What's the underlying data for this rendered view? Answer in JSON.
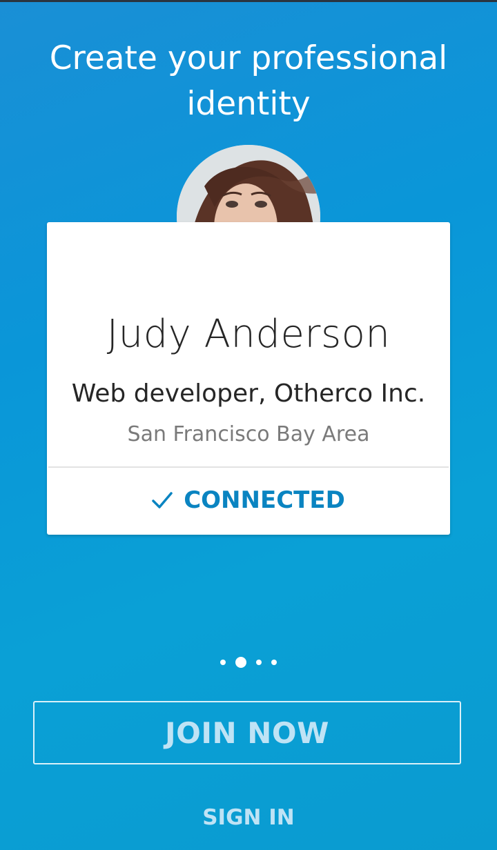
{
  "onboarding": {
    "headline": "Create your professional identity",
    "profile_card": {
      "name": "Judy Anderson",
      "title": "Web developer, Otherco Inc.",
      "location": "San Francisco Bay Area",
      "status": "CONNECTED",
      "status_icon": "check-icon"
    },
    "pager": {
      "total_pages": 4,
      "current_page": 2
    },
    "join_button_label": "JOIN NOW",
    "signin_label": "SIGN IN"
  },
  "colors": {
    "background": "#0a96d8",
    "accent": "#0a84c1",
    "card": "#ffffff",
    "button_text": "#bfe3f5"
  }
}
